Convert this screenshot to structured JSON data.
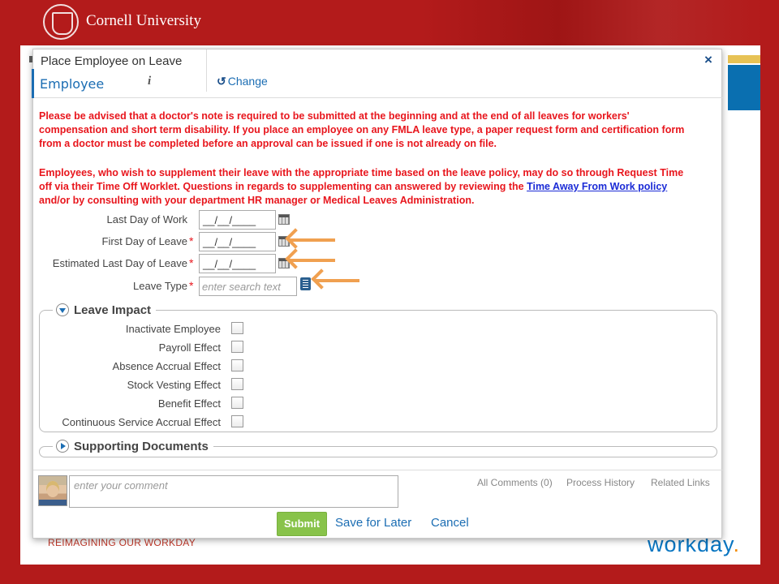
{
  "header": {
    "brand": "Cornell University",
    "seal_icon": "cornell-seal-icon"
  },
  "backdrop": {
    "tagline": "REIMAGINING OUR WORKDAY",
    "logo_text": "workday",
    "logo_dot": ".",
    "colors": {
      "cornell_red": "#b31b1b",
      "workday_blue": "#0875c1",
      "workday_orange": "#f38b00"
    }
  },
  "modal": {
    "title": "Place Employee on Leave",
    "employee_label": "Employee",
    "info_glyph": "i",
    "change_label": "Change",
    "close_glyph": "×",
    "warning_1": "Please be advised that a doctor's note is required to be submitted at the beginning and at the end of all leaves for workers' compensation and short term disability. If you place an employee on any FMLA leave type, a paper request form and certification form from a doctor must be completed before an approval can be issued if one is not already on file.",
    "warning_2_before": "Employees, who wish to supplement their leave with the appropriate time based on the leave policy, may do so through Request Time off via their Time Off Worklet. Questions in regards to supplementing can answered by reviewing the ",
    "warning_2_link": "Time Away From Work policy",
    "warning_2_after": " and/or by consulting with your department HR manager or Medical Leaves Administration.",
    "warning_color": "#e8161d"
  },
  "form": {
    "required_mark": "*",
    "fields": [
      {
        "label": "Last Day of Work",
        "value": "__/__/____",
        "required": false
      },
      {
        "label": "First Day of Leave",
        "value": "__/__/____",
        "required": true
      },
      {
        "label": "Estimated Last Day of Leave",
        "value": "__/__/____",
        "required": true
      },
      {
        "label": "Leave Type",
        "placeholder": "enter search text",
        "required": true
      }
    ]
  },
  "leave_impact": {
    "title": "Leave Impact",
    "items": [
      {
        "label": "Inactivate Employee",
        "checked": false
      },
      {
        "label": "Payroll Effect",
        "checked": false
      },
      {
        "label": "Absence Accrual Effect",
        "checked": false
      },
      {
        "label": "Stock Vesting Effect",
        "checked": false
      },
      {
        "label": "Benefit Effect",
        "checked": false
      },
      {
        "label": "Continuous Service Accrual Effect",
        "checked": false
      }
    ]
  },
  "supporting_documents": {
    "title": "Supporting Documents"
  },
  "footer": {
    "comment_placeholder": "enter your comment",
    "all_comments": "All Comments (0)",
    "process_history": "Process History",
    "related_links": "Related Links",
    "submit": "Submit",
    "save_later": "Save for Later",
    "cancel": "Cancel"
  }
}
